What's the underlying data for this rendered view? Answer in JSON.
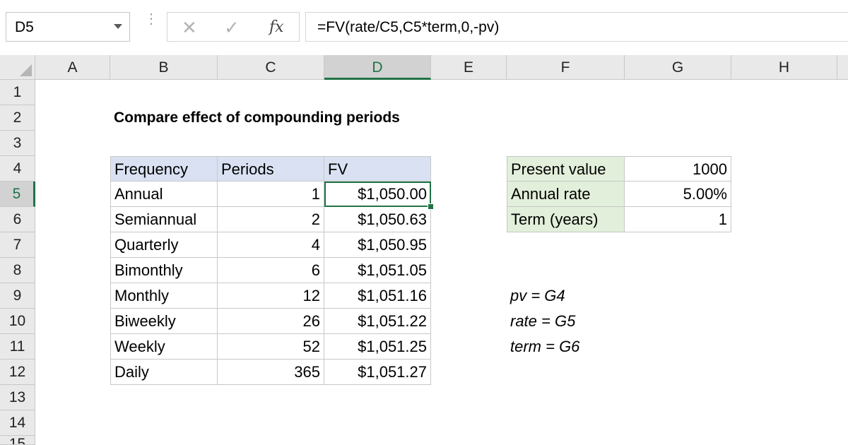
{
  "formula_bar": {
    "name_box": "D5",
    "cancel_glyph": "✕",
    "enter_glyph": "✓",
    "fx_label": "fx",
    "formula": "=FV(rate/C5,C5*term,0,-pv)"
  },
  "columns": [
    "A",
    "B",
    "C",
    "D",
    "E",
    "F",
    "G",
    "H"
  ],
  "rows": [
    "1",
    "2",
    "3",
    "4",
    "5",
    "6",
    "7",
    "8",
    "9",
    "10",
    "11",
    "12",
    "13",
    "14",
    "15"
  ],
  "selected_cell": "D5",
  "sheet": {
    "title": "Compare effect of compounding periods",
    "table": {
      "headers": [
        "Frequency",
        "Periods",
        "FV"
      ],
      "rows": [
        [
          "Annual",
          "1",
          "$1,050.00"
        ],
        [
          "Semiannual",
          "2",
          "$1,050.63"
        ],
        [
          "Quarterly",
          "4",
          "$1,050.95"
        ],
        [
          "Bimonthly",
          "6",
          "$1,051.05"
        ],
        [
          "Monthly",
          "12",
          "$1,051.16"
        ],
        [
          "Biweekly",
          "26",
          "$1,051.22"
        ],
        [
          "Weekly",
          "52",
          "$1,051.25"
        ],
        [
          "Daily",
          "365",
          "$1,051.27"
        ]
      ]
    },
    "inputs": [
      {
        "label": "Present value",
        "value": "1000"
      },
      {
        "label": "Annual rate",
        "value": "5.00%"
      },
      {
        "label": "Term (years)",
        "value": "1"
      }
    ],
    "notes": [
      "pv = G4",
      "rate = G5",
      "term = G6"
    ]
  },
  "colors": {
    "accent": "#217346",
    "table_header": "#d9e1f2",
    "input_label": "#e2efda"
  }
}
